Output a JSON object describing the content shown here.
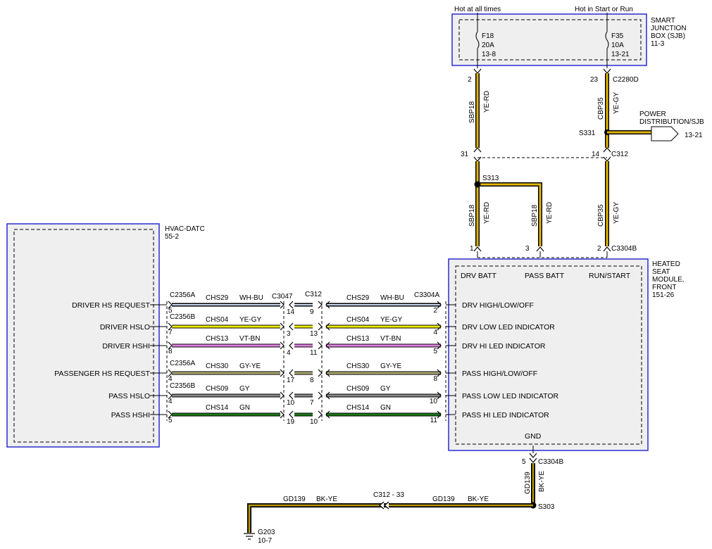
{
  "sjb": {
    "title_lines": [
      "SMART",
      "JUNCTION",
      "BOX (SJB)",
      "11-3"
    ],
    "hot_at_all_times": "Hot at all times",
    "hot_in_start_run": "Hot in Start or Run",
    "f18": [
      "F18",
      "20A",
      "13-8"
    ],
    "f35": [
      "F35",
      "10A",
      "13-21"
    ],
    "pin_left": "2",
    "pin_right": "23",
    "connector": "C2280D"
  },
  "upper_wires": {
    "left_circuit": "SBP18",
    "left_color": "YE-RD",
    "right_circuit": "CBP35",
    "right_color": "YE-GY",
    "splice_s331": "S331",
    "power_dist_lines": [
      "POWER",
      "DISTRIBUTION/SJB"
    ],
    "power_dist_ref": "13-21",
    "c312_pin_left": "31",
    "c312_pin_right": "14",
    "c312": "C312",
    "splice_s313": "S313"
  },
  "middle_wires": {
    "w1_circuit": "SBP18",
    "w1_color": "YE-RD",
    "w2_circuit": "SBP18",
    "w2_color": "YE-RD",
    "w3_circuit": "CBP35",
    "w3_color": "YE-GY",
    "pin1": "1",
    "pin3": "3",
    "pin2": "2",
    "connector": "C3304B"
  },
  "heated_seat": {
    "title_lines": [
      "HEATED",
      "SEAT",
      "MODULE,",
      "FRONT",
      "151-26"
    ],
    "drv_batt": "DRV BATT",
    "pass_batt": "PASS BATT",
    "run_start": "RUN/START",
    "gnd": "GND",
    "rows": [
      "DRV HIGH/LOW/OFF",
      "DRV LOW LED INDICATOR",
      "DRV HI LED INDICATOR",
      "PASS HIGH/LOW/OFF",
      "PASS LOW LED INDICATOR",
      "PASS HI LED INDICATOR"
    ]
  },
  "hvac": {
    "title_lines": [
      "HVAC-DATC",
      "55-2"
    ],
    "rows": [
      "DRIVER HS REQUEST",
      "DRIVER HSLO",
      "DRIVER HSHI",
      "PASSENGER HS REQUEST",
      "PASS HSLO",
      "PASS HSHI"
    ]
  },
  "signal_wires": [
    {
      "hvac_conn": "C2356A",
      "hvac_pin": "5",
      "circuit": "CHS29",
      "color": "WH-BU",
      "c3047_pin": "14",
      "c312_pin": "9",
      "c3304_conn": "C3304A",
      "c3304_pin": "2",
      "hex": "#9ab0e6",
      "type": "striped"
    },
    {
      "hvac_conn": "C2356B",
      "hvac_pin": "7",
      "circuit": "CHS04",
      "color": "YE-GY",
      "c3047_pin": "3",
      "c312_pin": "13",
      "c3304_conn": "",
      "c3304_pin": "4",
      "hex": "#ecec00",
      "type": "solid"
    },
    {
      "hvac_conn": "",
      "hvac_pin": "8",
      "circuit": "CHS13",
      "color": "VT-BN",
      "c3047_pin": "4",
      "c312_pin": "11",
      "c3304_conn": "",
      "c3304_pin": "5",
      "hex": "#e080e0",
      "type": "solid"
    },
    {
      "hvac_conn": "C2356A",
      "hvac_pin": "4",
      "circuit": "CHS30",
      "color": "GY-YE",
      "c3047_pin": "17",
      "c312_pin": "8",
      "c3304_conn": "",
      "c3304_pin": "8",
      "hex": "#aaa870",
      "type": "solid"
    },
    {
      "hvac_conn": "C2356B",
      "hvac_pin": "4",
      "circuit": "CHS09",
      "color": "GY",
      "c3047_pin": "10",
      "c312_pin": "7",
      "c3304_conn": "",
      "c3304_pin": "10",
      "hex": "#888888",
      "type": "solid"
    },
    {
      "hvac_conn": "",
      "hvac_pin": "5",
      "circuit": "CHS14",
      "color": "GN",
      "c3047_pin": "19",
      "c312_pin": "10",
      "c3304_conn": "",
      "c3304_pin": "11",
      "hex": "#1a7a1a",
      "type": "solid"
    }
  ],
  "connectors": {
    "c3047": "C3047",
    "c312": "C312"
  },
  "ground": {
    "pin": "5",
    "connector": "C3304B",
    "vertical_circuit": "GD139",
    "vertical_color": "BK-YE",
    "splice": "S303",
    "h_circuit_right": "GD139",
    "h_color_right": "BK-YE",
    "inline_conn": "C312 - 33",
    "h_circuit_left": "GD139",
    "h_color_left": "BK-YE",
    "ground_point": "G203",
    "ground_ref": "10-7"
  },
  "colors": {
    "module_border": "#2a2ad0",
    "module_fill": "#efefef",
    "ye_rd": "#e2b800",
    "ye_gy": "#e2b800",
    "bk_ye": "#b89a00"
  }
}
